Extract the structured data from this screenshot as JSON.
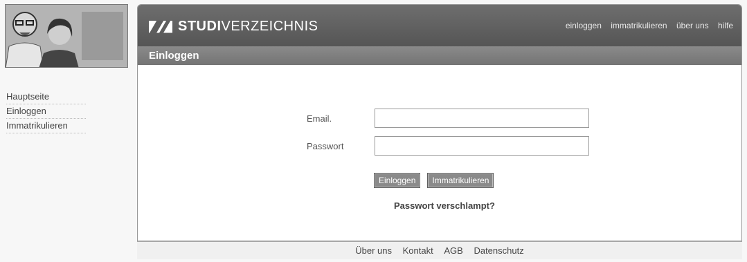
{
  "brand": {
    "logo_bold": "STUDI",
    "logo_light": "VERZEICHNIS"
  },
  "topnav": {
    "items": [
      "einloggen",
      "immatrikulieren",
      "über uns",
      "hilfe"
    ]
  },
  "page_title": "Einloggen",
  "left_nav": {
    "items": [
      "Hauptseite",
      "Einloggen",
      "Immatrikulieren"
    ]
  },
  "form": {
    "email_label": "Email.",
    "email_value": "",
    "password_label": "Passwort",
    "password_value": "",
    "login_button": "Einloggen",
    "register_button": "Immatrikulieren",
    "forgot_link": "Passwort verschlampt?"
  },
  "footer": {
    "items": [
      "Über uns",
      "Kontakt",
      "AGB",
      "Datenschutz"
    ]
  },
  "colors": {
    "header": "#5d5d5d",
    "title_bar": "#7f7f7f",
    "button": "#8a8a8a"
  }
}
